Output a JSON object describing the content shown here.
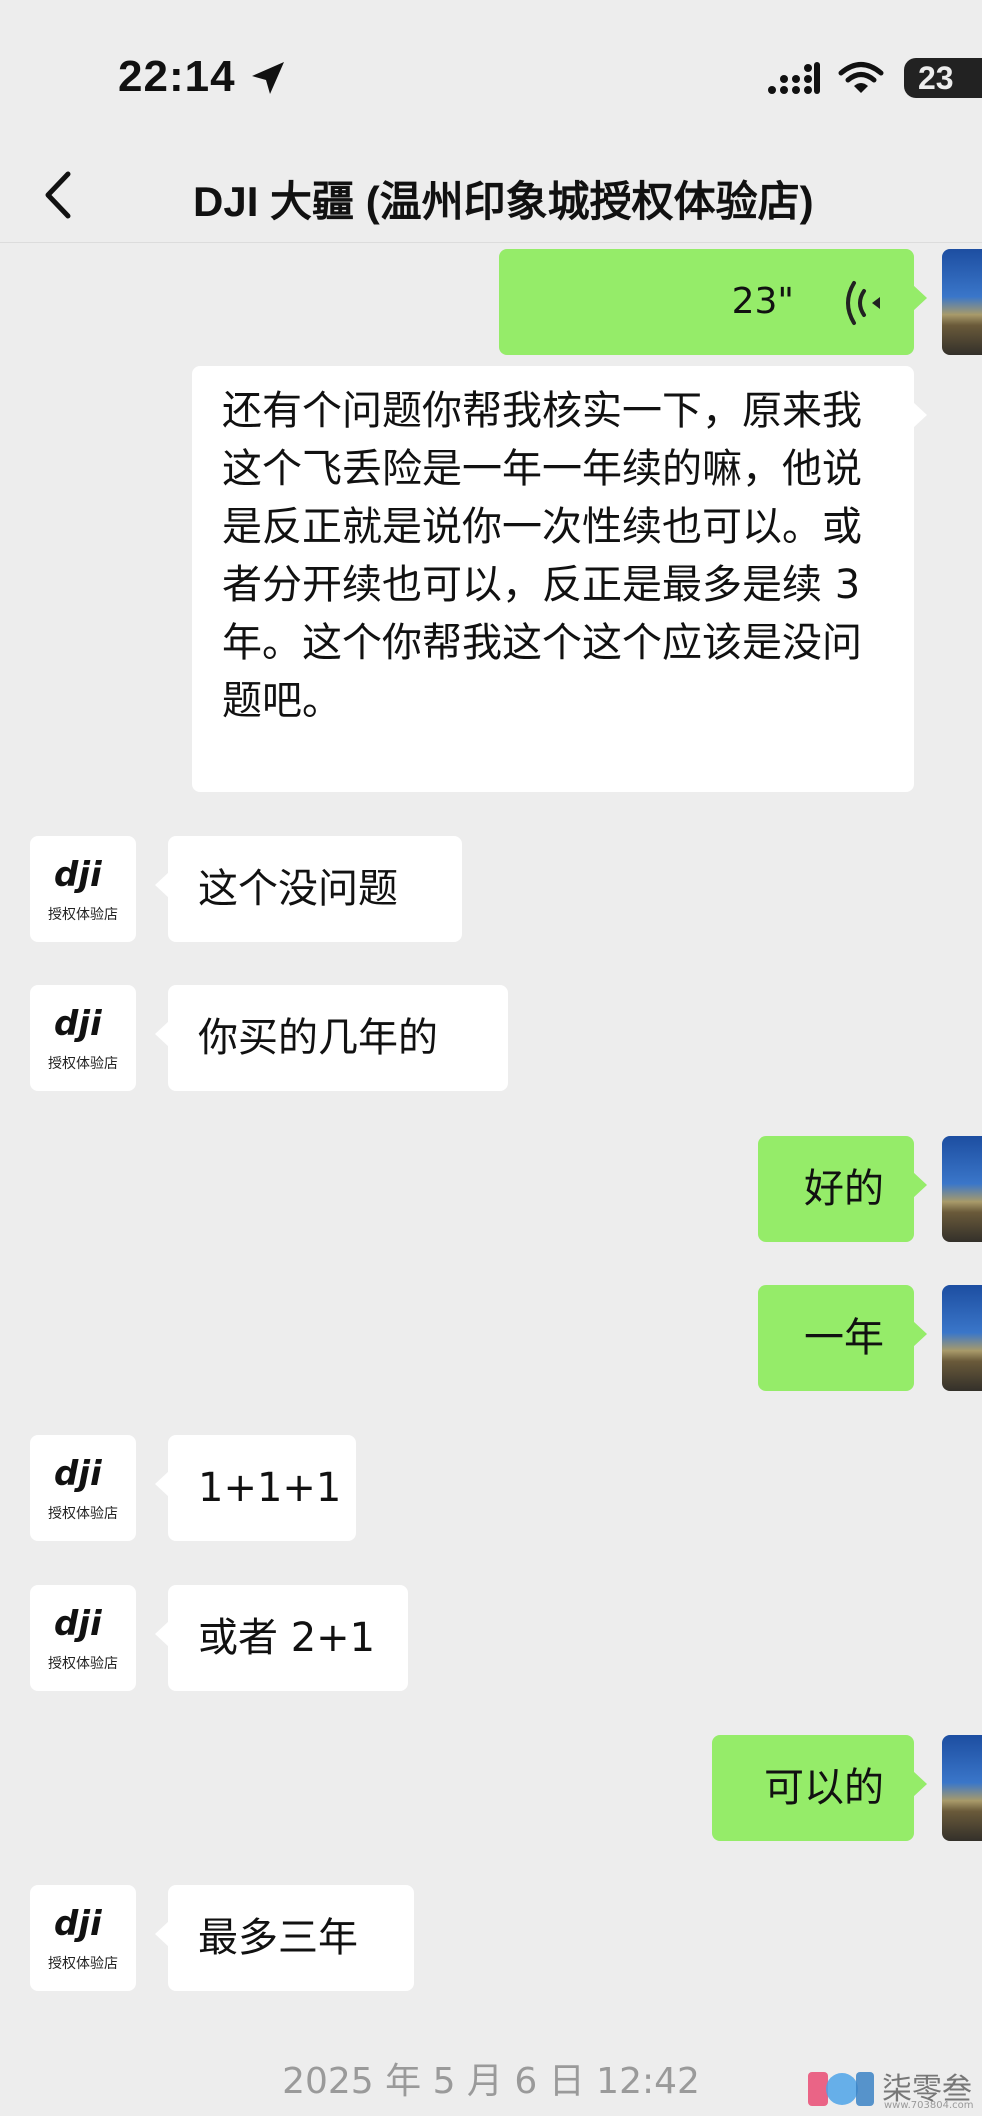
{
  "status_bar": {
    "time": "22:14",
    "battery": "23",
    "icons": [
      "location-arrow-icon",
      "signal-icon",
      "wifi-icon",
      "battery-icon"
    ]
  },
  "nav": {
    "back_icon": "chevron-left-icon",
    "title": "DJI 大疆 (温州印象城授权体验店)"
  },
  "dji_avatar": {
    "logo_text": "dji",
    "caption": "授权体验店"
  },
  "messages": {
    "voice": {
      "duration": "23\""
    },
    "long": {
      "text": "还有个问题你帮我核实一下，原来我这个飞丢险是一年一年续的嘛，他说是反正就是说你一次性续也可以。或者分开续也可以，反正是最多是续 3 年。这个你帮我这个这个应该是没问题吧。"
    },
    "m1": {
      "text": "这个没问题"
    },
    "m2": {
      "text": "你买的几年的"
    },
    "m3": {
      "text": "好的"
    },
    "m4": {
      "text": "一年"
    },
    "m5": {
      "text": "1+1+1"
    },
    "m6": {
      "text": "或者 2+1"
    },
    "m7": {
      "text": "可以的"
    },
    "m8": {
      "text": "最多三年"
    }
  },
  "timestamp": "2025 年 5 月 6 日 12:42",
  "watermark": {
    "text": "柒零叁",
    "url": "www.703804.com"
  },
  "colors": {
    "background": "#ededed",
    "outgoing_bubble": "#95ec69",
    "incoming_bubble": "#ffffff"
  }
}
